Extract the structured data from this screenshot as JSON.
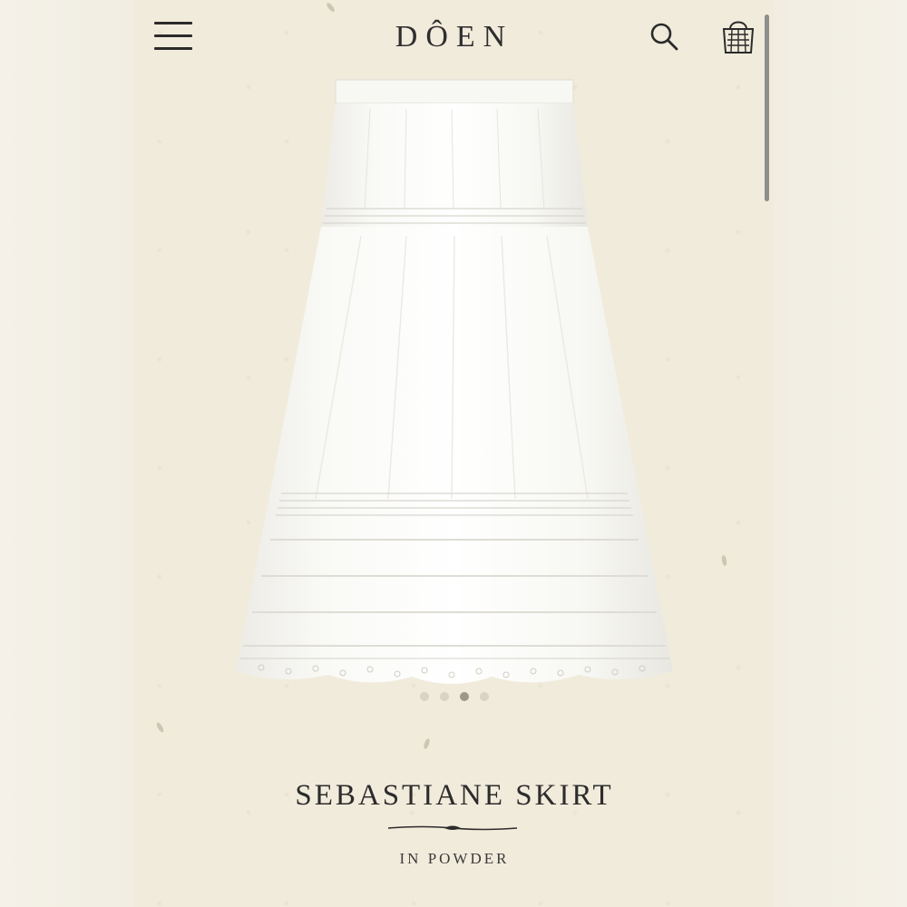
{
  "header": {
    "brand": "DÔEN",
    "icons": [
      "menu-icon",
      "search-icon",
      "shopping-bag-icon"
    ]
  },
  "product": {
    "name": "SEBASTIANE SKIRT",
    "variant": "IN POWDER",
    "image_alt": "white tiered cotton skirt"
  },
  "carousel": {
    "total": 4,
    "active": 3
  },
  "colors": {
    "background": "#f1ebdb",
    "text": "#2c2c2c",
    "skirt": "#f8f7f3"
  }
}
